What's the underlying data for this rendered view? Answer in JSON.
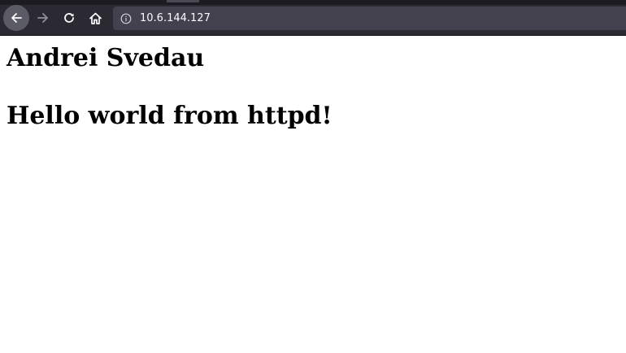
{
  "browser": {
    "address_bar": {
      "url": "10.6.144.127",
      "info_icon": "info-icon"
    },
    "toolbar": {
      "back_icon": "arrow-left-icon",
      "forward_icon": "arrow-right-icon",
      "reload_icon": "reload-icon",
      "home_icon": "home-icon"
    },
    "colors": {
      "toolbar_bg": "#2b2a33",
      "urlbar_bg": "#42414d",
      "page_bg": "#ffffff"
    }
  },
  "page": {
    "heading_author": "Andrei Svedau",
    "heading_message": "Hello world from httpd!"
  }
}
